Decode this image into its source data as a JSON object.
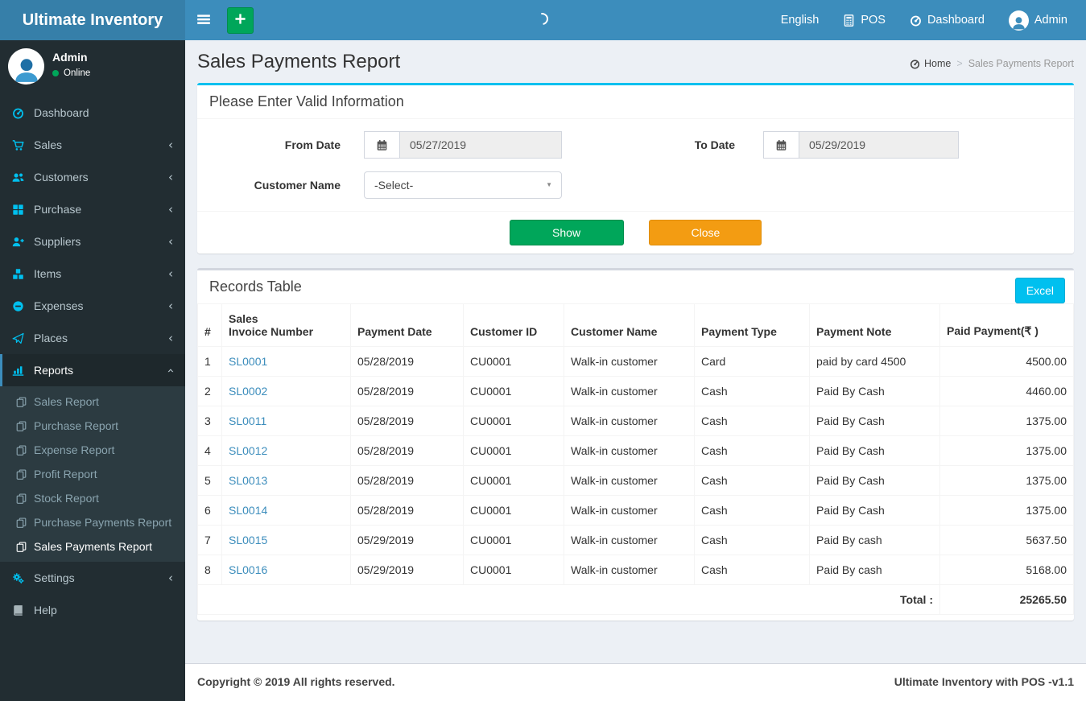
{
  "header": {
    "brand": "Ultimate Inventory",
    "nav": {
      "language": "English",
      "pos": "POS",
      "dashboard": "Dashboard",
      "user": "Admin"
    }
  },
  "sidebar": {
    "user": {
      "name": "Admin",
      "status": "Online"
    },
    "menu": [
      {
        "label": "Dashboard",
        "icon": "gauge",
        "chevron": "none"
      },
      {
        "label": "Sales",
        "icon": "cart",
        "chevron": "left"
      },
      {
        "label": "Customers",
        "icon": "users",
        "chevron": "left"
      },
      {
        "label": "Purchase",
        "icon": "grid",
        "chevron": "left"
      },
      {
        "label": "Suppliers",
        "icon": "user-plus",
        "chevron": "left"
      },
      {
        "label": "Items",
        "icon": "cubes",
        "chevron": "left"
      },
      {
        "label": "Expenses",
        "icon": "minus-circle",
        "chevron": "left"
      },
      {
        "label": "Places",
        "icon": "paper-plane",
        "chevron": "left"
      },
      {
        "label": "Reports",
        "icon": "bar-chart",
        "chevron": "down",
        "active": true,
        "children": [
          {
            "label": "Sales Report"
          },
          {
            "label": "Purchase Report"
          },
          {
            "label": "Expense Report"
          },
          {
            "label": "Profit Report"
          },
          {
            "label": "Stock Report"
          },
          {
            "label": "Purchase Payments Report"
          },
          {
            "label": "Sales Payments Report",
            "active": true
          }
        ]
      },
      {
        "label": "Settings",
        "icon": "gears",
        "chevron": "left"
      },
      {
        "label": "Help",
        "icon": "book",
        "chevron": "none",
        "muted_icon": true
      }
    ]
  },
  "page": {
    "title": "Sales Payments Report",
    "breadcrumb": {
      "home": "Home",
      "separator": ">",
      "current": "Sales Payments Report"
    }
  },
  "filter": {
    "title": "Please Enter Valid Information",
    "fields": {
      "from_date": {
        "label": "From Date",
        "value": "05/27/2019"
      },
      "to_date": {
        "label": "To Date",
        "value": "05/29/2019"
      },
      "customer_name": {
        "label": "Customer Name",
        "value": "-Select-"
      }
    },
    "buttons": {
      "show": "Show",
      "close": "Close"
    }
  },
  "records": {
    "title": "Records Table",
    "excel_button": "Excel",
    "table": {
      "columns": [
        "#",
        "Sales\nInvoice Number",
        "Payment Date",
        "Customer ID",
        "Customer Name",
        "Payment Type",
        "Payment Note",
        "Paid Payment(₹ )"
      ],
      "rows": [
        {
          "num": "1",
          "invoice": "SL0001",
          "date": "05/28/2019",
          "customer_id": "CU0001",
          "customer_name": "Walk-in customer",
          "type": "Card",
          "note": "paid by card 4500",
          "amount": "4500.00"
        },
        {
          "num": "2",
          "invoice": "SL0002",
          "date": "05/28/2019",
          "customer_id": "CU0001",
          "customer_name": "Walk-in customer",
          "type": "Cash",
          "note": "Paid By Cash",
          "amount": "4460.00"
        },
        {
          "num": "3",
          "invoice": "SL0011",
          "date": "05/28/2019",
          "customer_id": "CU0001",
          "customer_name": "Walk-in customer",
          "type": "Cash",
          "note": "Paid By Cash",
          "amount": "1375.00"
        },
        {
          "num": "4",
          "invoice": "SL0012",
          "date": "05/28/2019",
          "customer_id": "CU0001",
          "customer_name": "Walk-in customer",
          "type": "Cash",
          "note": "Paid By Cash",
          "amount": "1375.00"
        },
        {
          "num": "5",
          "invoice": "SL0013",
          "date": "05/28/2019",
          "customer_id": "CU0001",
          "customer_name": "Walk-in customer",
          "type": "Cash",
          "note": "Paid By Cash",
          "amount": "1375.00"
        },
        {
          "num": "6",
          "invoice": "SL0014",
          "date": "05/28/2019",
          "customer_id": "CU0001",
          "customer_name": "Walk-in customer",
          "type": "Cash",
          "note": "Paid By Cash",
          "amount": "1375.00"
        },
        {
          "num": "7",
          "invoice": "SL0015",
          "date": "05/29/2019",
          "customer_id": "CU0001",
          "customer_name": "Walk-in customer",
          "type": "Cash",
          "note": "Paid By cash",
          "amount": "5637.50"
        },
        {
          "num": "8",
          "invoice": "SL0016",
          "date": "05/29/2019",
          "customer_id": "CU0001",
          "customer_name": "Walk-in customer",
          "type": "Cash",
          "note": "Paid By cash",
          "amount": "5168.00"
        }
      ],
      "total_label": "Total :",
      "total_value": "25265.50"
    }
  },
  "footer": {
    "left": "Copyright © 2019 All rights reserved.",
    "right": "Ultimate Inventory with POS -v1.1"
  },
  "colors": {
    "navbar": "#3c8dbc",
    "logo": "#367fa9",
    "sidebar": "#222d32",
    "info": "#00c0ef",
    "success": "#00a65a",
    "warning": "#f39c12"
  }
}
